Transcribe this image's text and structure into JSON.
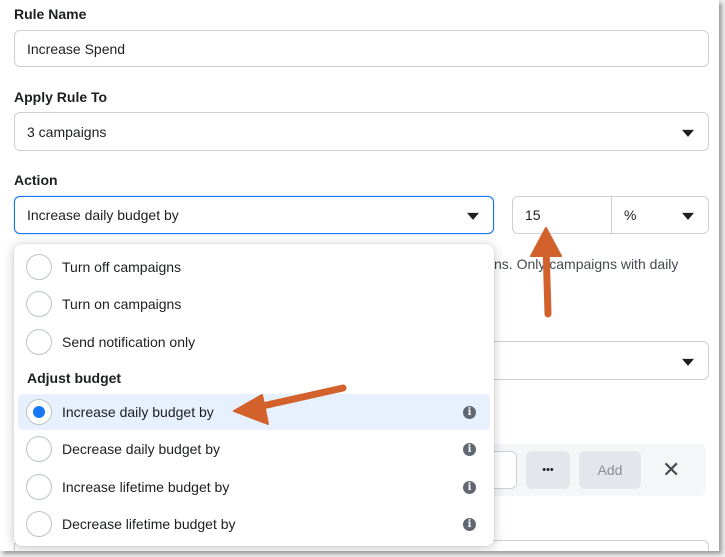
{
  "form": {
    "rule_name_label": "Rule Name",
    "rule_name_value": "Increase Spend",
    "apply_rule_label": "Apply Rule To",
    "apply_rule_value": "3 campaigns",
    "action_label": "Action",
    "action_value": "Increase daily budget by",
    "amount_value": "15",
    "unit_value": "%",
    "hint_text": "ns. Only campaigns with daily",
    "add_label": "Add",
    "more_label": "•••",
    "close_label": "✕"
  },
  "dropdown": {
    "options_top": [
      {
        "label": "Turn off campaigns",
        "selected": false
      },
      {
        "label": "Turn on campaigns",
        "selected": false
      },
      {
        "label": "Send notification only",
        "selected": false
      }
    ],
    "group_label": "Adjust budget",
    "options_budget": [
      {
        "label": "Increase daily budget by",
        "selected": true
      },
      {
        "label": "Decrease daily budget by",
        "selected": false
      },
      {
        "label": "Increase lifetime budget by",
        "selected": false
      },
      {
        "label": "Decrease lifetime budget by",
        "selected": false
      }
    ],
    "info_glyph": "i"
  },
  "colors": {
    "accent": "#1877f2",
    "selected_bg": "#e7f0fd",
    "annotation_arrow": "#d2612c"
  },
  "icons": {
    "dropdown": "caret-down-icon",
    "info": "info-icon",
    "close": "close-icon",
    "more": "more-icon"
  }
}
